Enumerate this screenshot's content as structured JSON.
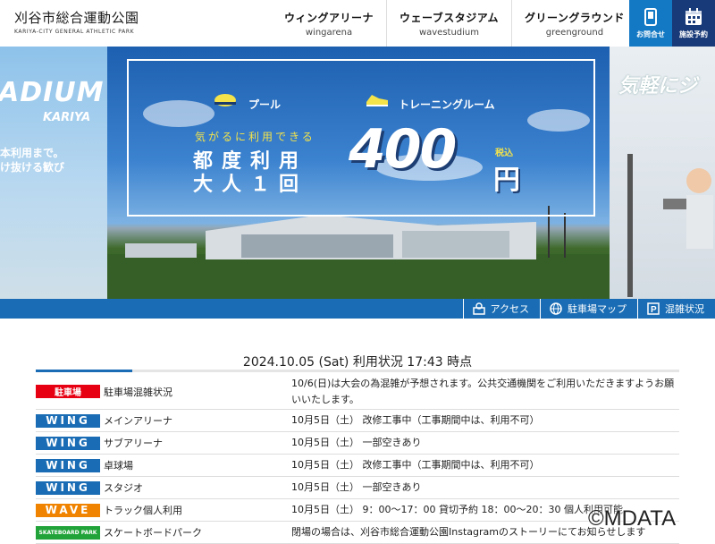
{
  "header": {
    "logo_ja": "刈谷市総合運動公園",
    "logo_en": "KARIYA-CITY GENERAL ATHLETIC PARK",
    "nav": [
      {
        "ja": "ウィングアリーナ",
        "en": "wingarena"
      },
      {
        "ja": "ウェーブスタジアム",
        "en": "wavestudium"
      },
      {
        "ja": "グリーングラウンド",
        "en": "greenground"
      }
    ],
    "contact_label": "お問合せ",
    "reserve_label": "施設予約"
  },
  "hero": {
    "left_big": "ADIUM",
    "left_kariya": "KARIYA",
    "left_text1": "本利用まで。",
    "left_text2": "け抜ける歓び",
    "pool": "プール",
    "gym": "トレーニングルーム",
    "sub": "気がるに利用できる",
    "line1": "都度利用",
    "line2": "大人１回",
    "price": "400",
    "tax": "税込",
    "yen": "円",
    "right_text": "気軽にジ"
  },
  "bluebar": [
    {
      "label": "アクセス",
      "icon": "access-icon"
    },
    {
      "label": "駐車場マップ",
      "icon": "globe-icon"
    },
    {
      "label": "混雑状況",
      "icon": "parking-icon"
    }
  ],
  "status": {
    "title": "2024.10.05 (Sat) 利用状況 17:43 時点",
    "rows": [
      {
        "tag": "駐車場",
        "tag_color": "#e60012",
        "name": "駐車場混雑状況",
        "info": "10/6(日)は大会の為混雑が予想されます。公共交通機関をご利用いただきますようお願いいたします。"
      },
      {
        "tag": "WING",
        "tag_color": "#1a6db5",
        "name": "メインアリーナ",
        "info": "10月5日（土） 改修工事中（工事期間中は、利用不可）"
      },
      {
        "tag": "WING",
        "tag_color": "#1a6db5",
        "name": "サブアリーナ",
        "info": "10月5日（土） 一部空きあり"
      },
      {
        "tag": "WING",
        "tag_color": "#1a6db5",
        "name": "卓球場",
        "info": "10月5日（土） 改修工事中（工事期間中は、利用不可）"
      },
      {
        "tag": "WING",
        "tag_color": "#1a6db5",
        "name": "スタジオ",
        "info": "10月5日（土） 一部空きあり"
      },
      {
        "tag": "WAVE",
        "tag_color": "#f08300",
        "name": "トラック個人利用",
        "info": "10月5日（土） 9：00～17：00 貸切予約 18：00～20：30 個人利用可能"
      },
      {
        "tag": "SKATEBOARD PARK",
        "tag_color": "#22a33a",
        "name": "スケートボードパーク",
        "info": "閉場の場合は、刈谷市総合運動公園Instagramのストーリーにてお知らせします"
      }
    ]
  },
  "watermark": "©MDATA"
}
